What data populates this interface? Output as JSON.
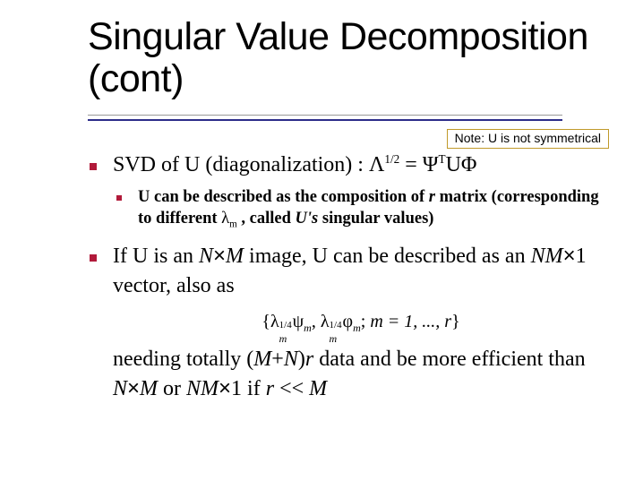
{
  "title": "Singular Value Decomposition (cont)",
  "note": "Note: U is not symmetrical",
  "bullet1_prefix": "SVD of ",
  "bullet1_var": "U",
  "bullet1_mid": " (diagonalization) : ",
  "eq1_lambda": "Λ",
  "eq1_exp": "1/2",
  "eq1_eq": " = ",
  "eq1_psi": "Ψ",
  "eq1_T": "T",
  "eq1_U": "U",
  "eq1_phi": "Φ",
  "sub1_a": "U",
  "sub1_b": " can be described as the composition of ",
  "sub1_r": "r",
  "sub1_c": " matrix (corresponding to different ",
  "sub1_lambda": "λ",
  "sub1_m": "m",
  "sub1_d": " , called ",
  "sub1_e": "U's",
  "sub1_f": " singular values)",
  "bullet2_a": "If ",
  "bullet2_U1": "U",
  "bullet2_b": " is an ",
  "bullet2_N": "N",
  "bullet2_x": "×",
  "bullet2_M": "M",
  "bullet2_c": " image, ",
  "bullet2_U2": "U",
  "bullet2_d": " can be described as an ",
  "bullet2_NM": "NM",
  "bullet2_one": "1",
  "bullet2_e": " vector, also as",
  "eq2_open": "{",
  "eq2_lambda1": "λ",
  "eq2_exp14": "1/4",
  "eq2_m": "m",
  "eq2_psi": "ψ",
  "eq2_comma": ", ",
  "eq2_lambda2": "λ",
  "eq2_phi": "φ",
  "eq2_semi": "; ",
  "eq2_range": "m = 1, ..., r",
  "eq2_close": "}",
  "cont_a": "needing totally (",
  "cont_M": "M",
  "cont_plus": "+",
  "cont_N": "N",
  "cont_b": ")",
  "cont_r": "r",
  "cont_c": " data and be more efficient than ",
  "cont_NxM_N": "N",
  "cont_NxM_M": "M",
  "cont_or": " or ",
  "cont_NM": "NM",
  "cont_one": "1",
  "cont_if": " if ",
  "cont_r2": "r",
  "cont_lt": " << ",
  "cont_M2": "M"
}
